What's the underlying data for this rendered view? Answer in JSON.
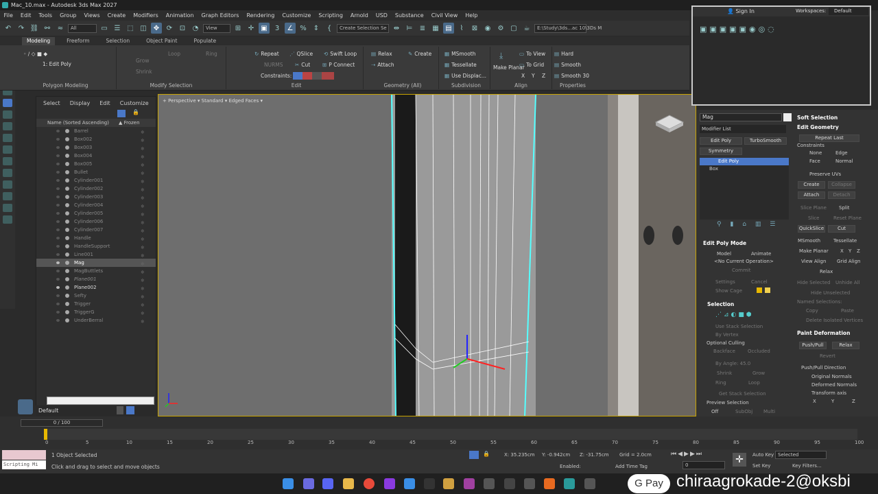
{
  "window": {
    "title": "Mac_10.max - Autodesk 3ds Max 2027"
  },
  "menu": [
    "File",
    "Edit",
    "Tools",
    "Group",
    "Views",
    "Create",
    "Modifiers",
    "Animation",
    "Graph Editors",
    "Rendering",
    "Customize",
    "Scripting",
    "Arnold",
    "USD",
    "Substance",
    "Civil View",
    "Help"
  ],
  "main_toolbar": {
    "filter": "All",
    "ref_coord": "View",
    "selection_set": "Create Selection Se",
    "path": "E:\\Study\\3ds...ac 10\\3Ds M"
  },
  "workspace": {
    "sign_in": "Sign In",
    "label": "Workspaces:",
    "value": "Default"
  },
  "ribbon": {
    "tabs": [
      "Modeling",
      "Freeform",
      "Selection",
      "Object Paint",
      "Populate"
    ],
    "active_tab": "Modeling",
    "edit_poly_label": "1: Edit Poly",
    "groups": [
      "Polygon Modeling",
      "Modify Selection",
      "Edit",
      "Geometry (All)",
      "Subdivision",
      "Align",
      "Properties"
    ],
    "modify_sel": {
      "grow": "Grow",
      "shrink": "Shrink",
      "loop": "Loop",
      "ring": "Ring"
    },
    "edit": {
      "repeat": "Repeat",
      "qslice": "QSlice",
      "swift_loop": "Swift Loop",
      "nurms": "NURMS",
      "cut": "Cut",
      "p_connect": "P Connect",
      "constraints": "Constraints:"
    },
    "geometry": {
      "relax": "Relax",
      "create": "Create",
      "attach": "Attach"
    },
    "subdivision": {
      "msmooth": "MSmooth",
      "tessellate": "Tessellate",
      "use_displac": "Use Displac..."
    },
    "align": {
      "make_planar": "Make Planar",
      "to_view": "To View",
      "to_grid": "To Grid",
      "x": "X",
      "y": "Y",
      "z": "Z"
    },
    "properties": {
      "hard": "Hard",
      "smooth": "Smooth",
      "smooth30": "Smooth 30"
    }
  },
  "scene_explorer": {
    "tabs": [
      "Select",
      "Display",
      "Edit",
      "Customize"
    ],
    "col_name": "Name (Sorted Ascending)",
    "col_frozen": "▲ Frozen",
    "items": [
      {
        "name": "Barrel",
        "vis": false
      },
      {
        "name": "Box002",
        "vis": false
      },
      {
        "name": "Box003",
        "vis": false
      },
      {
        "name": "Box004",
        "vis": false
      },
      {
        "name": "Box005",
        "vis": false
      },
      {
        "name": "Bullet",
        "vis": false
      },
      {
        "name": "Cylinder001",
        "vis": false
      },
      {
        "name": "Cylinder002",
        "vis": false
      },
      {
        "name": "Cylinder003",
        "vis": false
      },
      {
        "name": "Cylinder004",
        "vis": false
      },
      {
        "name": "Cylinder005",
        "vis": false
      },
      {
        "name": "Cylinder006",
        "vis": false
      },
      {
        "name": "Cylinder007",
        "vis": false
      },
      {
        "name": "Handle",
        "vis": false
      },
      {
        "name": "HandleSupport",
        "vis": false
      },
      {
        "name": "Line001",
        "vis": false
      },
      {
        "name": "Mag",
        "vis": true,
        "sel": true
      },
      {
        "name": "MagButtlets",
        "vis": false
      },
      {
        "name": "Plane001",
        "vis": false,
        "ital": true
      },
      {
        "name": "Plane002",
        "vis": true
      },
      {
        "name": "Sefty",
        "vis": false
      },
      {
        "name": "Trigger",
        "vis": false
      },
      {
        "name": "TriggerG",
        "vis": false
      },
      {
        "name": "UnderBerral",
        "vis": false
      }
    ],
    "layer": "Default"
  },
  "viewport": {
    "view": "Perspective",
    "shading": "Standard",
    "faces": "Edged Faces"
  },
  "command_panel": {
    "object_name": "Mag",
    "modifier_list": "Modifier List",
    "buttons": [
      "Edit Poly",
      "TurboSmooth",
      "Symmetry"
    ],
    "stack": [
      "Edit Poly",
      "Box"
    ],
    "edit_poly_mode": {
      "title": "Edit Poly Mode",
      "model": "Model",
      "animate": "Animate",
      "no_op": "<No Current Operation>",
      "commit": "Commit",
      "settings": "Settings",
      "cancel": "Cancel",
      "show_cage": "Show Cage"
    },
    "selection": {
      "title": "Selection",
      "use_stack": "Use Stack Selection",
      "by_vertex": "By Vertex",
      "optional_culling": "Optional Culling",
      "backface": "Backface",
      "occluded": "Occluded",
      "by_angle": "By Angle: 45.0",
      "shrink": "Shrink",
      "grow": "Grow",
      "ring": "Ring",
      "loop": "Loop",
      "get_stack": "Get Stack Selection",
      "preview": "Preview Selection",
      "off": "Off",
      "subobj": "SubObj",
      "multi": "Multi"
    },
    "soft_selection": "Soft Selection",
    "edit_geometry": {
      "title": "Edit Geometry",
      "repeat_last": "Repeat Last",
      "constraints": "Constraints",
      "none": "None",
      "edge": "Edge",
      "face": "Face",
      "normal": "Normal",
      "preserve_uvs": "Preserve UVs",
      "create": "Create",
      "collapse": "Collapse",
      "attach": "Attach",
      "detach": "Detach",
      "slice_plane": "Slice Plane",
      "split": "Split",
      "slice": "Slice",
      "reset_plane": "Reset Plane",
      "quickslice": "QuickSlice",
      "cut": "Cut",
      "msmooth": "MSmooth",
      "tessellate": "Tessellate",
      "make_planar": "Make Planar",
      "x": "X",
      "y": "Y",
      "z": "Z",
      "view_align": "View Align",
      "grid_align": "Grid Align",
      "relax": "Relax",
      "hide_selected": "Hide Selected",
      "unhide_all": "Unhide All",
      "hide_unselected": "Hide Unselected",
      "named_selections": "Named Selections:",
      "copy": "Copy",
      "paste": "Paste",
      "delete_isolated": "Delete Isolated Vertices"
    },
    "paint_deformation": {
      "title": "Paint Deformation",
      "push_pull": "Push/Pull",
      "relax": "Relax",
      "revert": "Revert",
      "direction": "Push/Pull Direction",
      "original": "Original Normals",
      "deformed": "Deformed Normals",
      "transform_axis": "Transform axis",
      "x": "X",
      "y": "Y",
      "z": "Z"
    }
  },
  "timeline": {
    "frame": "0 / 100",
    "ticks": [
      "0",
      "5",
      "10",
      "15",
      "20",
      "25",
      "30",
      "35",
      "40",
      "45",
      "50",
      "55",
      "60",
      "65",
      "70",
      "75",
      "80",
      "85",
      "90",
      "95",
      "100"
    ]
  },
  "status": {
    "script_label": "Scripting Mi",
    "objects_selected": "1 Object Selected",
    "hint": "Click and drag to select and move objects",
    "x": "X: 35.235cm",
    "y": "Y: -0.942cm",
    "z": "Z: -31.75cm",
    "grid": "Grid = 2.0cm",
    "enabled": "Enabled:",
    "add_time_tag": "Add Time Tag",
    "auto_key": "Auto Key",
    "set_key": "Set Key",
    "selected": "Selected",
    "key_filters": "Key Filters...",
    "frame_field": "0"
  },
  "overlay": {
    "gpay": "G Pay",
    "upi": "chiraagrokade-2@oksbi"
  },
  "colors": {
    "viewport_border": "#c9a400",
    "selection_blue": "#4a78c8",
    "wire": "#ffffff"
  }
}
